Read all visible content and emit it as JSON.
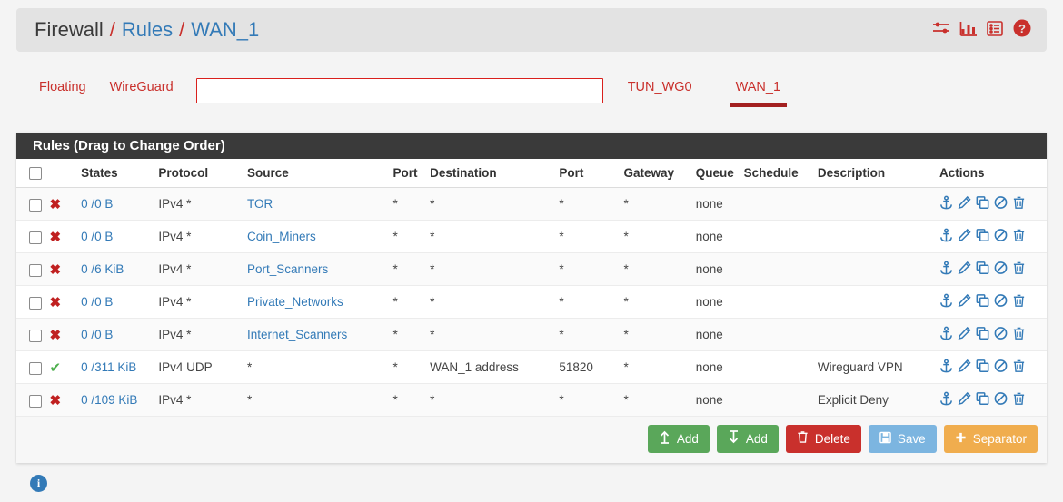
{
  "breadcrumb": {
    "root": "Firewall",
    "sep": "/",
    "section": "Rules",
    "current": "WAN_1"
  },
  "header_icons": [
    {
      "name": "sliders-icon",
      "title": "Advanced"
    },
    {
      "name": "chart-bar-icon",
      "title": "Status"
    },
    {
      "name": "list-icon",
      "title": "Log"
    },
    {
      "name": "help-icon",
      "title": "Help"
    }
  ],
  "tabs": [
    {
      "label": "Floating",
      "active": false,
      "blank": false
    },
    {
      "label": "WireGuard",
      "active": false,
      "blank": false
    },
    {
      "label": "",
      "active": false,
      "blank": true
    },
    {
      "label": "TUN_WG0",
      "active": false,
      "blank": false
    },
    {
      "label": "WAN_1",
      "active": true,
      "blank": false
    }
  ],
  "panel": {
    "heading": "Rules (Drag to Change Order)"
  },
  "table": {
    "columns": [
      "States",
      "Protocol",
      "Source",
      "Port",
      "Destination",
      "Port",
      "Gateway",
      "Queue",
      "Schedule",
      "Description",
      "Actions"
    ],
    "rows": [
      {
        "action": "block",
        "states": "0 /0 B",
        "protocol": "IPv4 *",
        "source": "TOR",
        "source_link": true,
        "port1": "*",
        "destination": "*",
        "port2": "*",
        "gateway": "*",
        "queue": "none",
        "schedule": "",
        "description": ""
      },
      {
        "action": "block",
        "states": "0 /0 B",
        "protocol": "IPv4 *",
        "source": "Coin_Miners",
        "source_link": true,
        "port1": "*",
        "destination": "*",
        "port2": "*",
        "gateway": "*",
        "queue": "none",
        "schedule": "",
        "description": ""
      },
      {
        "action": "block",
        "states": "0 /6 KiB",
        "protocol": "IPv4 *",
        "source": "Port_Scanners",
        "source_link": true,
        "port1": "*",
        "destination": "*",
        "port2": "*",
        "gateway": "*",
        "queue": "none",
        "schedule": "",
        "description": ""
      },
      {
        "action": "block",
        "states": "0 /0 B",
        "protocol": "IPv4 *",
        "source": "Private_Networks",
        "source_link": true,
        "port1": "*",
        "destination": "*",
        "port2": "*",
        "gateway": "*",
        "queue": "none",
        "schedule": "",
        "description": ""
      },
      {
        "action": "block",
        "states": "0 /0 B",
        "protocol": "IPv4 *",
        "source": "Internet_Scanners",
        "source_link": true,
        "port1": "*",
        "destination": "*",
        "port2": "*",
        "gateway": "*",
        "queue": "none",
        "schedule": "",
        "description": ""
      },
      {
        "action": "pass",
        "states": "0 /311 KiB",
        "protocol": "IPv4 UDP",
        "source": "*",
        "source_link": false,
        "port1": "*",
        "destination": "WAN_1 address",
        "port2": "51820",
        "gateway": "*",
        "queue": "none",
        "schedule": "",
        "description": "Wireguard VPN"
      },
      {
        "action": "block",
        "states": "0 /109 KiB",
        "protocol": "IPv4 *",
        "source": "*",
        "source_link": false,
        "port1": "*",
        "destination": "*",
        "port2": "*",
        "gateway": "*",
        "queue": "none",
        "schedule": "",
        "description": "Explicit Deny"
      }
    ],
    "row_action_icons": [
      "anchor-icon",
      "pencil-icon",
      "copy-icon",
      "ban-icon",
      "trash-icon"
    ]
  },
  "buttons": [
    {
      "label": "Add",
      "icon": "arrow-up-icon",
      "style": "green"
    },
    {
      "label": "Add",
      "icon": "arrow-down-icon",
      "style": "green"
    },
    {
      "label": "Delete",
      "icon": "trash-icon",
      "style": "red"
    },
    {
      "label": "Save",
      "icon": "save-icon",
      "style": "blue"
    },
    {
      "label": "Separator",
      "icon": "plus-icon",
      "style": "orange"
    }
  ],
  "footer": {
    "info_icon_label": "i"
  },
  "colors": {
    "accent_red": "#c9302c",
    "link_blue": "#337ab7",
    "pass_green": "#4cae4c",
    "deny_red": "#c02020",
    "panel_dark": "#3a3a3a",
    "page_bg": "#f4f4f4"
  }
}
